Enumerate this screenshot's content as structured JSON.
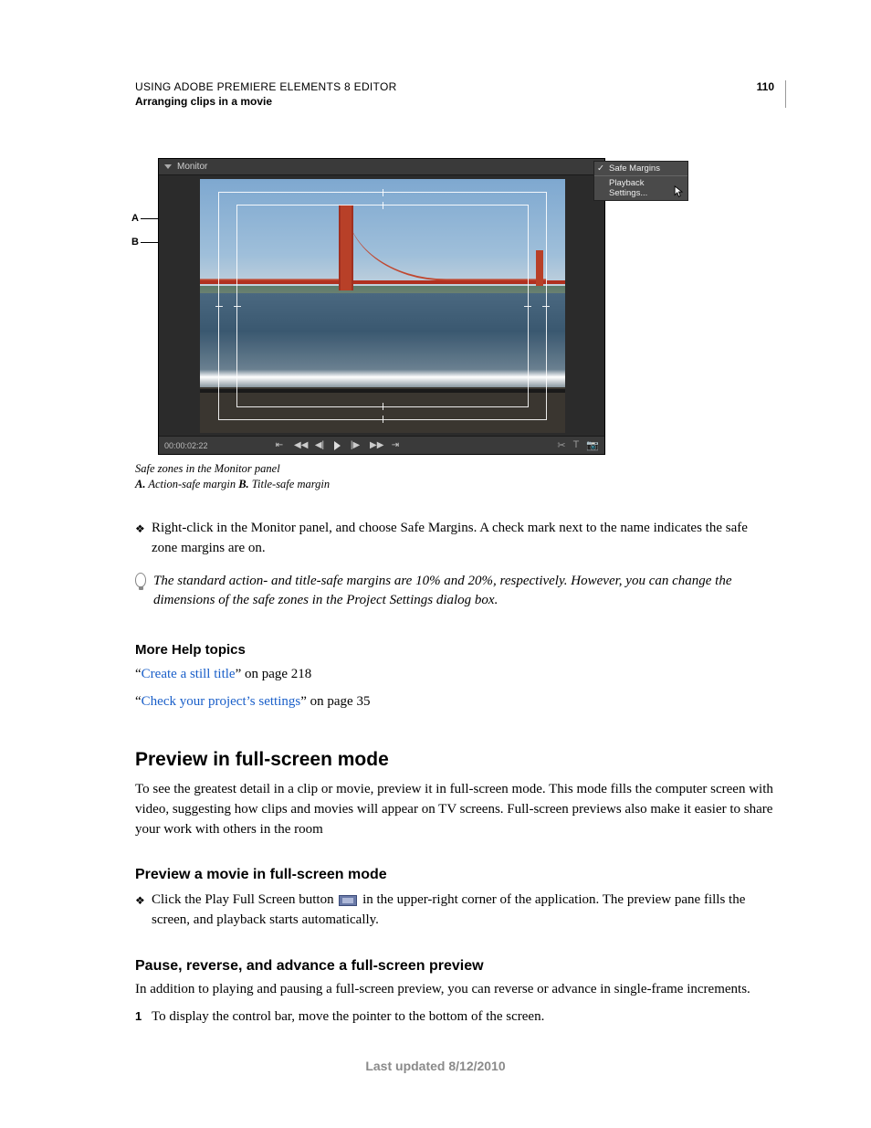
{
  "header": {
    "doc_title": "USING ADOBE PREMIERE ELEMENTS 8 EDITOR",
    "doc_section": "Arranging clips in a movie",
    "page_number": "110"
  },
  "figure": {
    "panel_title": "Monitor",
    "timecode": "00:00:02:22",
    "context_menu": {
      "item1": "Safe Margins",
      "item2": "Playback Settings..."
    },
    "callout_a": "A",
    "callout_b": "B",
    "caption": "Safe zones in the Monitor panel",
    "key_a_label": "A.",
    "key_a_text": " Action-safe margin  ",
    "key_b_label": "B.",
    "key_b_text": " Title-safe margin"
  },
  "bullet1": "Right-click in the Monitor panel, and choose Safe Margins. A check mark next to the name indicates the safe zone margins are on.",
  "tip": "The standard action- and title-safe margins are 10% and 20%, respectively. However, you can change the dimensions of the safe zones in the Project Settings dialog box.",
  "more_help": {
    "heading": "More Help topics",
    "link1_open": "“",
    "link1_text": "Create a still title",
    "link1_rest": "” on page 218",
    "link2_open": "“",
    "link2_text": "Check your project’s settings",
    "link2_rest": "” on page 35"
  },
  "section": {
    "h2": "Preview in full-screen mode",
    "para": "To see the greatest detail in a clip or movie, preview it in full-screen mode. This mode fills the computer screen with video, suggesting how clips and movies will appear on TV screens. Full-screen previews also make it easier to share your work with others in the room"
  },
  "sub1": {
    "h3": "Preview a movie in full-screen mode",
    "bullet_pre": "Click the Play Full Screen button ",
    "bullet_post": " in the upper-right corner of the application. The preview pane fills the screen, and playback starts automatically."
  },
  "sub2": {
    "h3": "Pause, reverse, and advance a full-screen preview",
    "para": "In addition to playing and pausing a full-screen preview, you can reverse or advance in single-frame increments.",
    "num1_marker": "1",
    "num1_text": "To display the control bar, move the pointer to the bottom of the screen."
  },
  "footer": {
    "updated": "Last updated 8/12/2010"
  }
}
